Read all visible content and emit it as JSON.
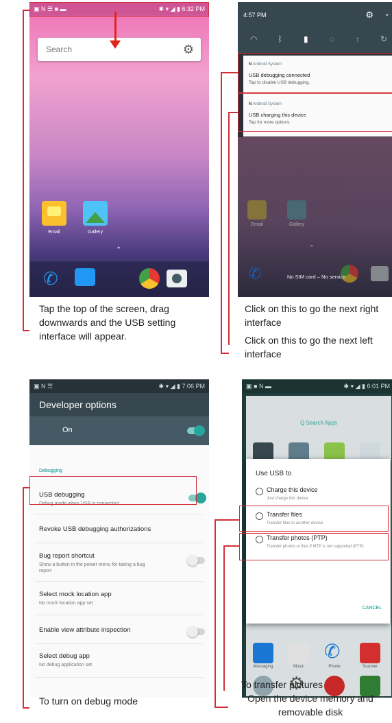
{
  "panel1": {
    "status_time": "6:32 PM",
    "search_placeholder": "Search",
    "apps": [
      {
        "label": "Email",
        "icon": "email-icon"
      },
      {
        "label": "Gallery",
        "icon": "gallery-icon"
      }
    ],
    "dock_icons": [
      "phone-icon",
      "messages-icon",
      "chrome-icon",
      "camera-icon"
    ],
    "caption": "Tap the top of the screen, drag downwards and the USB setting interface will appear."
  },
  "panel2": {
    "status_time": "4:57 PM",
    "notifications": [
      {
        "source": "Android System",
        "title": "USB debugging connected",
        "subtitle": "Tap to disable USB debugging."
      },
      {
        "source": "Android System",
        "title": "USB charging this device",
        "subtitle": "Tap for more options."
      }
    ],
    "apps": [
      {
        "label": "Email",
        "icon": "email-icon"
      },
      {
        "label": "Gallery",
        "icon": "gallery-icon"
      }
    ],
    "sim_text": "No SIM card – No service",
    "caption_right": "Click on this to go the next right interface",
    "caption_left": "Click on this to go the next left interface"
  },
  "panel3": {
    "status_time": "7:06 PM",
    "title": "Developer options",
    "master_label": "On",
    "section": "Debugging",
    "rows": [
      {
        "title": "USB debugging",
        "subtitle": "Debug mode when USB is connected",
        "toggle": "on"
      },
      {
        "title": "Revoke USB debugging authorizations",
        "subtitle": ""
      },
      {
        "title": "Bug report shortcut",
        "subtitle": "Show a button in the power menu for taking a bug report",
        "toggle": "off"
      },
      {
        "title": "Select mock location app",
        "subtitle": "No mock location app set"
      },
      {
        "title": "Enable view attribute inspection",
        "subtitle": "",
        "toggle": "off"
      },
      {
        "title": "Select debug app",
        "subtitle": "No debug application set"
      }
    ],
    "caption": "To turn on debug mode"
  },
  "panel4": {
    "status_time": "6:01 PM",
    "search_label": "Q Search Apps",
    "dialog_title": "Use USB to",
    "options": [
      {
        "title": "Charge this device",
        "subtitle": "Just charge this device"
      },
      {
        "title": "Transfer files",
        "subtitle": "Transfer files to another device"
      },
      {
        "title": "Transfer photos (PTP)",
        "subtitle": "Transfer photos or files if MTP is not supported (PTP)"
      }
    ],
    "cancel_label": "CANCEL",
    "bottom_apps": [
      "Messaging",
      "Music",
      "Phone",
      "Scanner"
    ],
    "caption_pictures": "To transfer pictures",
    "caption_memory": "Open the device memory and removable disk"
  },
  "colors": {
    "annotation_red": "#d32f3a",
    "accent_teal": "#009688"
  }
}
